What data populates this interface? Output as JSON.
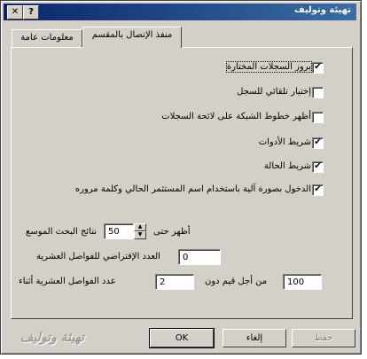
{
  "window": {
    "title": "تهيئة وتوليف",
    "help_button": "?",
    "close_button": "✕"
  },
  "tabs": [
    {
      "label": "منفذ الإتصال بالمقسم",
      "active": true
    },
    {
      "label": "معلومات عامة",
      "active": false
    }
  ],
  "options": [
    {
      "label": "بروز السجلات المختارة",
      "checked": true,
      "mark": "✔"
    },
    {
      "label": "إختيار تلقائي للسجل",
      "checked": false,
      "mark": ""
    },
    {
      "label": "أظهر خطوط الشبكة على لائحة السجلات",
      "checked": false,
      "mark": ""
    },
    {
      "label": "شريط الأدوات",
      "checked": true,
      "mark": "✔"
    },
    {
      "label": "شريط الحالة",
      "checked": true,
      "mark": "✔"
    },
    {
      "label": "الدخول بصورة آلية باستخدام اسم المستثمر الحالي وكلمة مروره",
      "checked": true,
      "mark": "✔"
    }
  ],
  "search": {
    "prefix_label": "أظهر حتى",
    "value": "50",
    "suffix_label": "نتائج البحث الموسع",
    "up_arrow": "▲",
    "down_arrow": "▼"
  },
  "decimals": {
    "label": "العدد الإفتراضي للفواصل العشرية",
    "value": "0"
  },
  "decimal_places": {
    "label_right": "عدد الفواصل العشرية أثناء",
    "value": "2",
    "label_mid": "من أجل قيم دون",
    "threshold_value": "100"
  },
  "buttons": {
    "save": "حفظ",
    "cancel": "إلغاء",
    "ok": "OK"
  },
  "watermark": "تهيئة وتوليف"
}
